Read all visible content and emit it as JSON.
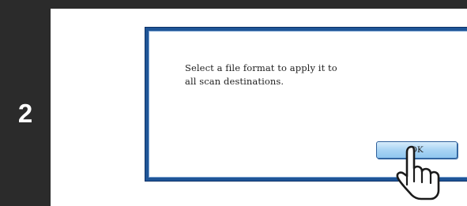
{
  "step": {
    "number": "2"
  },
  "dialog": {
    "message_lines": [
      "Select a file format to apply it to",
      "all scan destinations."
    ],
    "ok_label": "OK"
  },
  "icons": {
    "pointer": "hand-pointer-icon"
  },
  "colors": {
    "sidebar": "#2b2b2b",
    "dialog_frame": "#1f5597",
    "button_face": "#a9d4f4",
    "button_border": "#2d5f9a"
  }
}
